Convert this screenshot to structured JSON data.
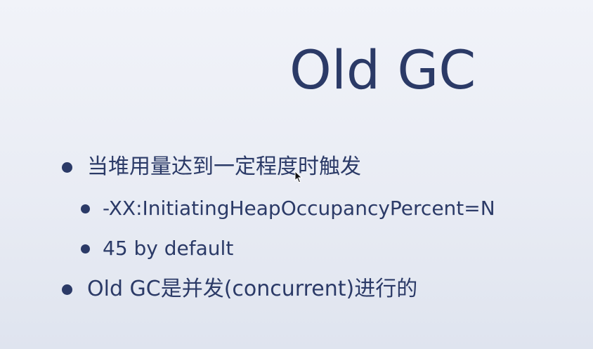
{
  "slide": {
    "title": "Old GC",
    "bullets": [
      {
        "text": "当堆用量达到一定程度时触发",
        "sub": [
          {
            "text": "-XX:InitiatingHeapOccupancyPercent=N"
          },
          {
            "text": "45 by default"
          }
        ]
      },
      {
        "text": "Old GC是并发(concurrent)进行的"
      }
    ]
  },
  "colors": {
    "text": "#2b3a67",
    "background_top": "#f1f3f9",
    "background_bottom": "#dfe4ef"
  },
  "icons": {
    "pointer": "mouse-cursor-icon"
  }
}
